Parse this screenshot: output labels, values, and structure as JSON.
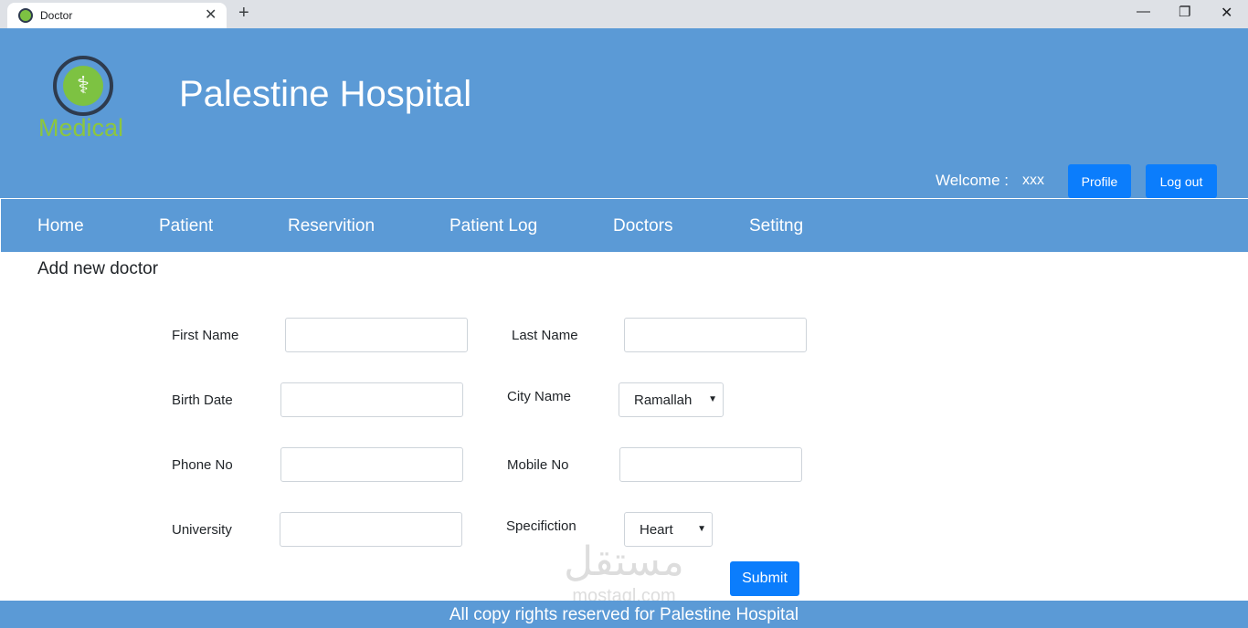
{
  "browser": {
    "tab_title": "Doctor",
    "close_glyph": "✕",
    "new_tab_glyph": "+",
    "minimize_glyph": "—",
    "maximize_glyph": "❐",
    "window_close_glyph": "✕"
  },
  "header": {
    "logo_text": "Medical",
    "logo_glyph": "⚕",
    "title": "Palestine Hospital",
    "welcome_label": "Welcome :",
    "welcome_user": "xxx",
    "profile_label": "Profile",
    "logout_label": "Log out"
  },
  "nav": {
    "items": [
      {
        "label": "Home"
      },
      {
        "label": "Patient"
      },
      {
        "label": "Reservition"
      },
      {
        "label": "Patient Log"
      },
      {
        "label": "Doctors"
      },
      {
        "label": "Setitng"
      }
    ]
  },
  "page": {
    "heading": "Add new doctor"
  },
  "form": {
    "first_name_label": "First Name",
    "first_name_value": "",
    "last_name_label": "Last Name",
    "last_name_value": "",
    "birth_date_label": "Birth Date",
    "birth_date_value": "",
    "city_label": "City Name",
    "city_value": "Ramallah",
    "phone_label": "Phone No",
    "phone_value": "",
    "mobile_label": "Mobile No",
    "mobile_value": "",
    "university_label": "University",
    "university_value": "",
    "specification_label": "Specifiction",
    "specification_value": "Heart",
    "submit_label": "Submit"
  },
  "watermark": {
    "arabic": "مستقل",
    "latin": "mostaql.com"
  },
  "footer": {
    "text": "All copy rights reserved for Palestine Hospital"
  },
  "colors": {
    "header_bg": "#5b9ad6",
    "button_bg": "#0b7dfc",
    "logo_green": "#7dc242"
  }
}
